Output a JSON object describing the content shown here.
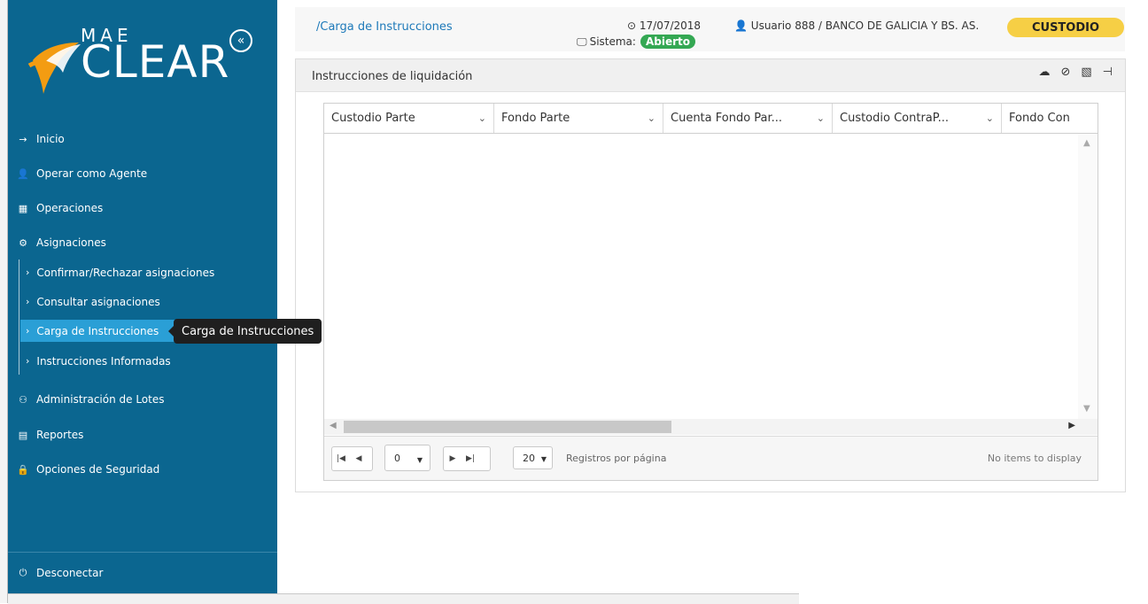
{
  "sidebar": {
    "logo": {
      "small": "MAE",
      "big": "CLEAR"
    },
    "collapse_icon": "«",
    "menu": [
      {
        "label": "Inicio",
        "icon": "→"
      },
      {
        "label": "Operar como Agente",
        "icon": "👤"
      },
      {
        "label": "Operaciones",
        "icon": "▦"
      },
      {
        "label": "Asignaciones",
        "icon": "⚙"
      }
    ],
    "submenu": [
      {
        "label": "Confirmar/Rechazar asignaciones"
      },
      {
        "label": "Consultar asignaciones"
      },
      {
        "label": "Carga de Instrucciones"
      },
      {
        "label": "Instrucciones Informadas"
      }
    ],
    "menu2": [
      {
        "label": "Administración de Lotes",
        "icon": "⚇"
      },
      {
        "label": "Reportes",
        "icon": "▤"
      },
      {
        "label": "Opciones de Seguridad",
        "icon": "🔒"
      }
    ],
    "logout": {
      "label": "Desconectar",
      "icon": "⏻"
    },
    "tooltip": "Carga de Instrucciones"
  },
  "header": {
    "breadcrumb": "/Carga de Instrucciones",
    "date": "17/07/2018",
    "system_label": "Sistema:",
    "system_status": "Abierto",
    "user": "Usuario 888 / BANCO DE GALICIA Y BS. AS.",
    "role": "CUSTODIO"
  },
  "panel": {
    "title": "Instrucciones de liquidación",
    "grid": {
      "columns": [
        "Custodio Parte",
        "Fondo Parte",
        "Cuenta Fondo Par...",
        "Custodio ContraP...",
        "Fondo Con"
      ]
    },
    "pager": {
      "page": "0",
      "page_size": "20",
      "per_page_label": "Registros por página",
      "no_items": "No items to display"
    }
  },
  "colors": {
    "sidebar_bg": "#0b6690",
    "active_item": "#2a9fd6",
    "role_badge": "#f6cf45",
    "status_green": "#34a853",
    "link": "#1d79b9"
  }
}
